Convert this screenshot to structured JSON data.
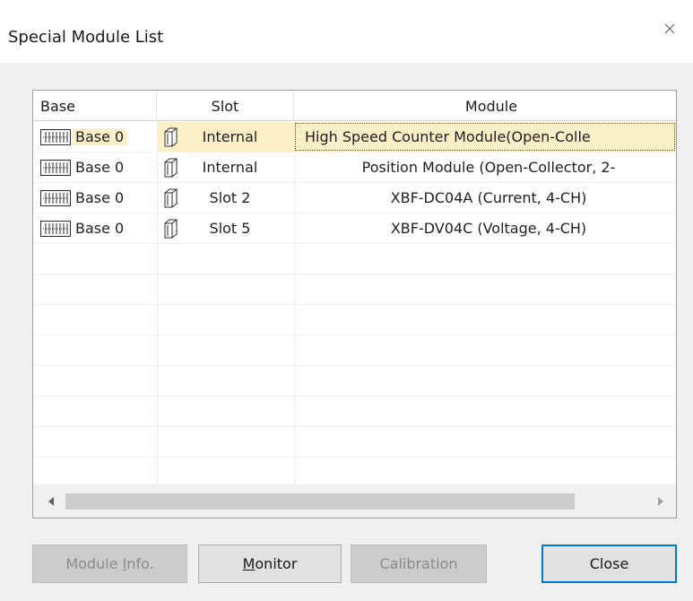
{
  "window": {
    "title": "Special Module List",
    "close_glyph": "×"
  },
  "list": {
    "columns": [
      "Base",
      "Slot",
      "Module"
    ],
    "rows": [
      {
        "base": "Base 0",
        "slot": "Internal",
        "module": "High Speed Counter Module(Open-Colle",
        "selected": true
      },
      {
        "base": "Base 0",
        "slot": "Internal",
        "module": "Position Module (Open-Collector, 2-",
        "selected": false
      },
      {
        "base": "Base 0",
        "slot": "Slot 2",
        "module": "XBF-DC04A (Current, 4-CH)",
        "selected": false
      },
      {
        "base": "Base 0",
        "slot": "Slot 5",
        "module": "XBF-DV04C (Voltage, 4-CH)",
        "selected": false
      }
    ],
    "empty_row_count": 8,
    "icons": {
      "base": "base-rack-icon",
      "slot": "module-slot-icon"
    }
  },
  "scrollbar": {
    "left_icon": "scroll-left-arrow-icon",
    "right_icon": "scroll-right-arrow-icon"
  },
  "buttons": {
    "module_info": {
      "prefix": "Module ",
      "mnemonic": "I",
      "suffix": "nfo.",
      "enabled": false
    },
    "monitor": {
      "prefix": "",
      "mnemonic": "M",
      "suffix": "onitor",
      "enabled": true
    },
    "calibration": {
      "label": "Calibration",
      "enabled": false
    },
    "close": {
      "label": "Close",
      "enabled": true,
      "default": true
    }
  },
  "colors": {
    "selection": "#fdf0c8",
    "default_button_border": "#0078d7",
    "window_bg": "#f0f0f0"
  }
}
